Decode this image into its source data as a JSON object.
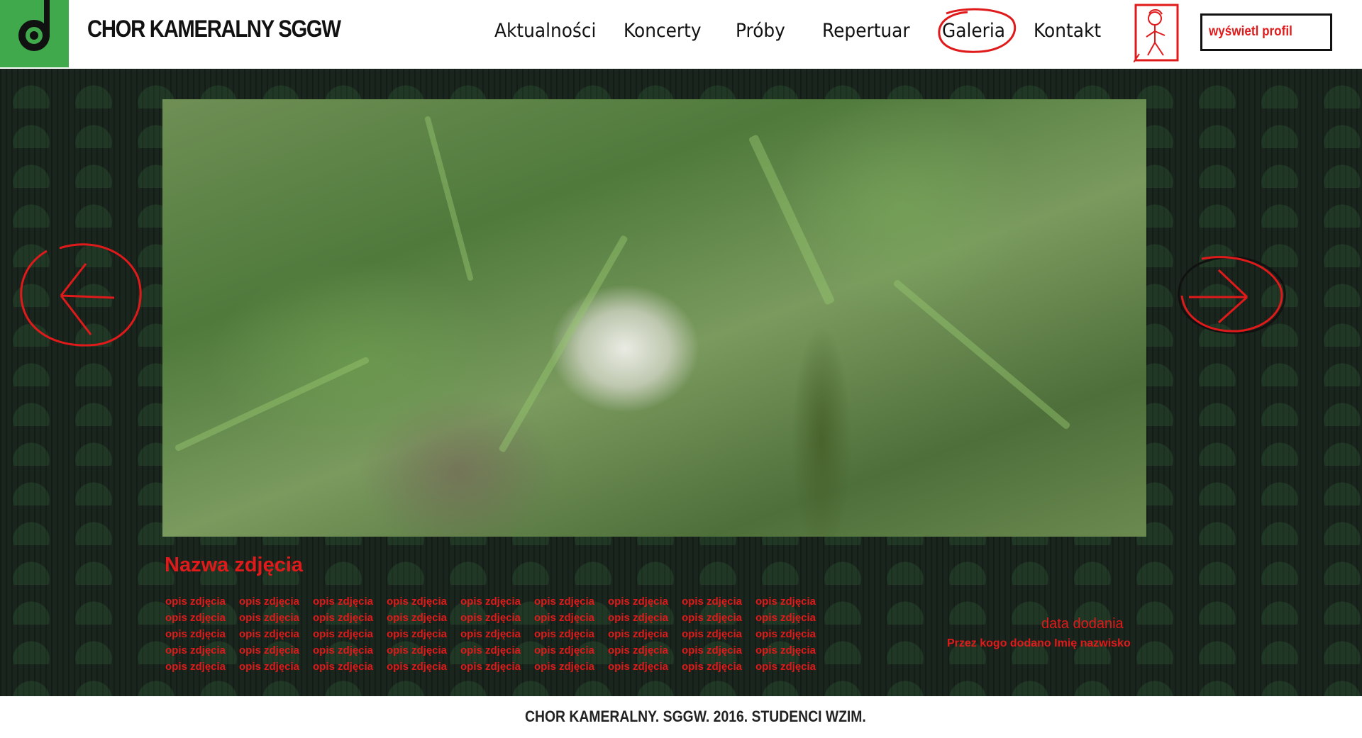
{
  "header": {
    "site_title": "CHOR KAMERALNY SGGW",
    "nav": [
      "Aktualności",
      "Koncerty",
      "Próby",
      "Repertuar",
      "Galeria",
      "Kontakt"
    ],
    "active_nav": "Galeria",
    "profile_button": "wyświetl profil"
  },
  "gallery": {
    "photo_title": "Nazwa zdjęcia",
    "date_added": "data dodania",
    "added_by": "Przez kogo dodano Imię nazwisko",
    "description_word": "opis zdjęcia"
  },
  "footer": {
    "text": "CHOR KAMERALNY. SGGW. 2016. STUDENCI WZIM."
  },
  "colors": {
    "brand_green": "#3fa94b",
    "main_bg": "#1a261d",
    "accent_red": "#e01a1a"
  },
  "icons": {
    "logo": "music-note-logo-icon",
    "avatar": "stick-figure-avatar-icon",
    "prev": "arrow-left-icon",
    "next": "arrow-right-icon"
  }
}
